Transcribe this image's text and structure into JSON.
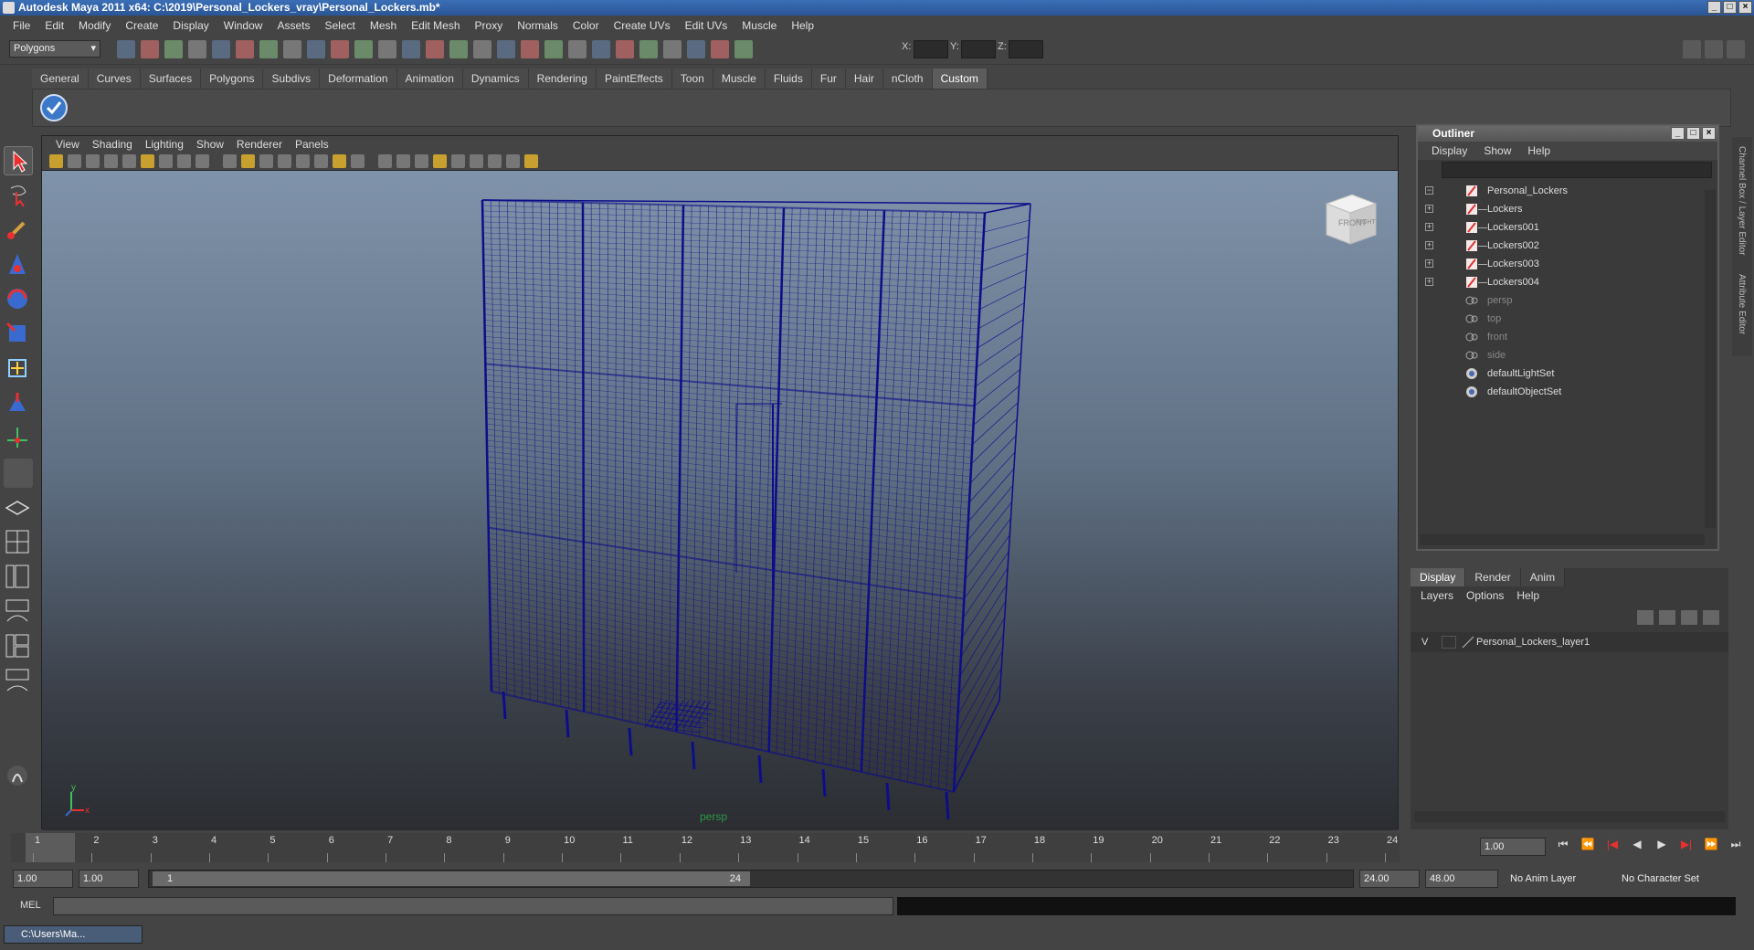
{
  "window": {
    "title": "Autodesk Maya 2011 x64: C:\\2019\\Personal_Lockers_vray\\Personal_Lockers.mb*"
  },
  "menubar": [
    "File",
    "Edit",
    "Modify",
    "Create",
    "Display",
    "Window",
    "Assets",
    "Select",
    "Mesh",
    "Edit Mesh",
    "Proxy",
    "Normals",
    "Color",
    "Create UVs",
    "Edit UVs",
    "Muscle",
    "Help"
  ],
  "status": {
    "mode": "Polygons",
    "x_label": "X:",
    "y_label": "Y:",
    "z_label": "Z:"
  },
  "shelf_tabs": [
    "General",
    "Curves",
    "Surfaces",
    "Polygons",
    "Subdivs",
    "Deformation",
    "Animation",
    "Dynamics",
    "Rendering",
    "PaintEffects",
    "Toon",
    "Muscle",
    "Fluids",
    "Fur",
    "Hair",
    "nCloth",
    "Custom"
  ],
  "viewport": {
    "menu": [
      "View",
      "Shading",
      "Lighting",
      "Show",
      "Renderer",
      "Panels"
    ],
    "camera_label": "persp",
    "viewcube_front": "FRONT",
    "viewcube_right": "RIGHT"
  },
  "outliner": {
    "title": "Outliner",
    "menu": [
      "Display",
      "Show",
      "Help"
    ],
    "items": [
      {
        "label": "Personal_Lockers",
        "expand": "−"
      },
      {
        "label": "Lockers",
        "expand": "+"
      },
      {
        "label": "Lockers001",
        "expand": "+"
      },
      {
        "label": "Lockers002",
        "expand": "+"
      },
      {
        "label": "Lockers003",
        "expand": "+"
      },
      {
        "label": "Lockers004",
        "expand": "+"
      },
      {
        "label": "persp",
        "expand": ""
      },
      {
        "label": "top",
        "expand": ""
      },
      {
        "label": "front",
        "expand": ""
      },
      {
        "label": "side",
        "expand": ""
      },
      {
        "label": "defaultLightSet",
        "expand": ""
      },
      {
        "label": "defaultObjectSet",
        "expand": ""
      }
    ]
  },
  "layers": {
    "tabs": [
      "Display",
      "Render",
      "Anim"
    ],
    "menu": [
      "Layers",
      "Options",
      "Help"
    ],
    "row": {
      "visible": "V",
      "name": "Personal_Lockers_layer1"
    }
  },
  "timeline": {
    "ticks": [
      "1",
      "2",
      "3",
      "4",
      "5",
      "6",
      "7",
      "8",
      "9",
      "10",
      "11",
      "12",
      "13",
      "14",
      "15",
      "16",
      "17",
      "18",
      "19",
      "20",
      "21",
      "22",
      "23",
      "24"
    ],
    "current_frame": "1.00"
  },
  "range": {
    "start": "1.00",
    "start2": "1.00",
    "slider_start": "1",
    "slider_end": "24",
    "end": "24.00",
    "end2": "48.00",
    "anim_layer": "No Anim Layer",
    "char_set": "No Character Set"
  },
  "cmdline": {
    "label": "MEL"
  },
  "taskbar": {
    "item": "C:\\Users\\Ma..."
  },
  "colors": {
    "wireframe": "#0d0d8a",
    "accent": "#2f5a9a"
  }
}
